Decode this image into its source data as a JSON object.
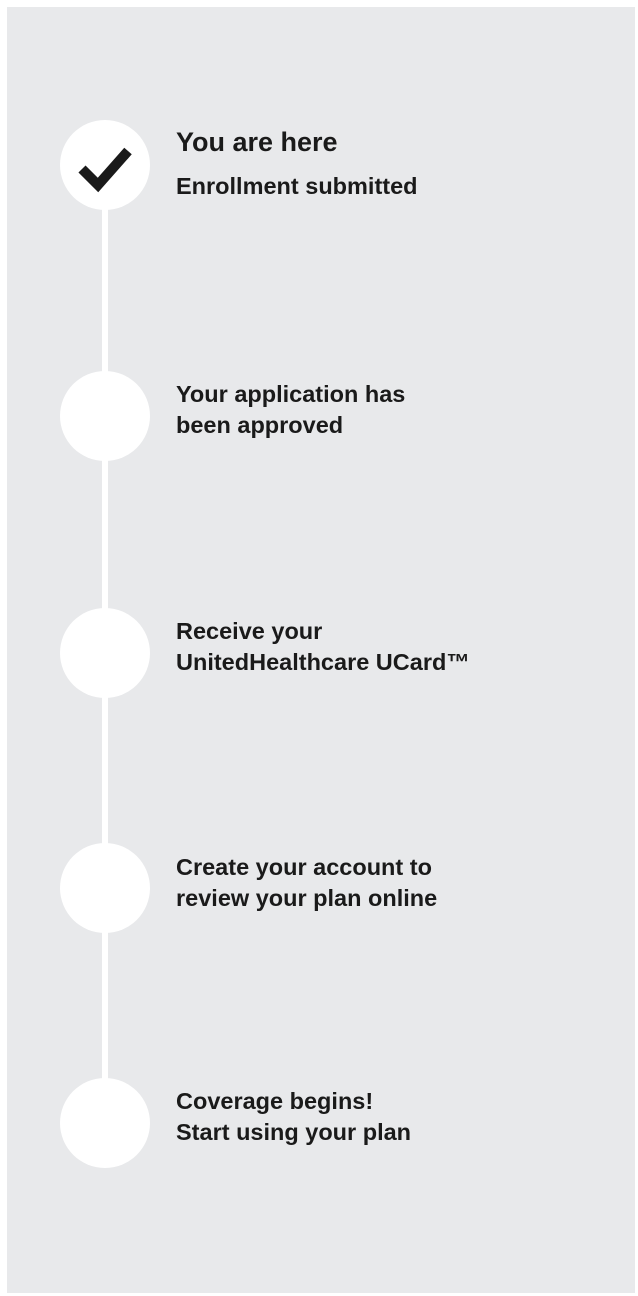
{
  "steps": [
    {
      "state": "current",
      "icon": "check-icon",
      "status_label": "You are here",
      "lines": [
        "Enrollment submitted"
      ]
    },
    {
      "state": "upcoming",
      "lines": [
        "Your application has",
        "been approved"
      ]
    },
    {
      "state": "upcoming",
      "lines": [
        "Receive your",
        "UnitedHealthcare UCard™"
      ]
    },
    {
      "state": "upcoming",
      "lines": [
        "Create your account to",
        "review your plan online"
      ]
    },
    {
      "state": "upcoming",
      "lines": [
        "Coverage begins!",
        "Start using your plan"
      ]
    }
  ],
  "colors": {
    "background": "#e8e9eb",
    "marker": "#ffffff",
    "text": "#1a1a1a"
  }
}
